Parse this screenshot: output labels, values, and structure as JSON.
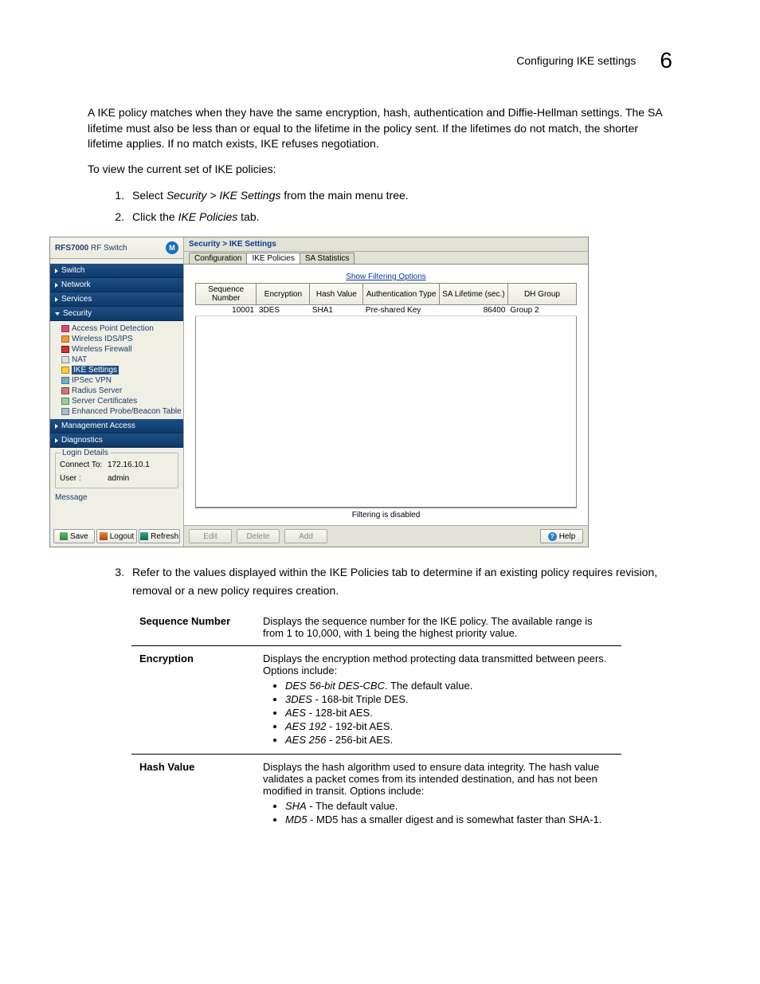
{
  "header": {
    "title": "Configuring IKE settings",
    "page_number": "6"
  },
  "body": {
    "p1": "A IKE policy matches when they have the same encryption, hash, authentication and Diffie-Hellman settings. The SA lifetime must also be less than or equal to the lifetime in the policy sent. If the lifetimes do not match, the shorter lifetime applies. If no match exists, IKE refuses negotiation.",
    "p2": "To view the current set of IKE policies:",
    "step1_prefix": "Select ",
    "step1_em": "Security > IKE Settings",
    "step1_suffix": " from the main menu tree.",
    "step2_prefix": "Click the ",
    "step2_em": "IKE Policies",
    "step2_suffix": " tab.",
    "step3": "Refer to the values displayed within the IKE Policies tab to determine if an existing policy requires revision, removal or a new policy requires creation."
  },
  "shot": {
    "brand_bold": "RFS7000",
    "brand_rest": " RF Switch",
    "logo_text": "M",
    "sections": {
      "switch": "Switch",
      "network": "Network",
      "services": "Services",
      "security": "Security",
      "mgmt": "Management Access",
      "diag": "Diagnostics"
    },
    "tree": {
      "t0": "Access Point Detection",
      "t1": "Wireless IDS/IPS",
      "t2": "Wireless Firewall",
      "t3": "NAT",
      "t4": "IKE Settings",
      "t5": "IPSec VPN",
      "t6": "Radius Server",
      "t7": "Server Certificates",
      "t8": "Enhanced Probe/Beacon Table"
    },
    "login": {
      "title": "Login Details",
      "connect_k": "Connect To:",
      "connect_v": "172.16.10.1",
      "user_k": "User :",
      "user_v": "admin"
    },
    "msg": "Message",
    "footer_btns": {
      "save": "Save",
      "logout": "Logout",
      "refresh": "Refresh"
    },
    "crumb": "Security > IKE Settings",
    "tabs": {
      "t0": "Configuration",
      "t1": "IKE Policies",
      "t2": "SA Statistics"
    },
    "filter_link": "Show Filtering Options",
    "cols": {
      "c0": "Sequence Number",
      "c1": "Encryption",
      "c2": "Hash Value",
      "c3": "Authentication Type",
      "c4": "SA Lifetime (sec.)",
      "c5": "DH Group"
    },
    "row0": {
      "c0": "10001",
      "c1": "3DES",
      "c2": "SHA1",
      "c3": "Pre-shared Key",
      "c4": "86400",
      "c5": "Group 2"
    },
    "filter_msg": "Filtering is disabled",
    "main_btns": {
      "edit": "Edit",
      "delete": "Delete",
      "add": "Add",
      "help": "Help"
    }
  },
  "def": {
    "r0": {
      "term": "Sequence Number",
      "desc": "Displays the sequence number for the IKE policy. The available range is from 1 to 10,000, with 1 being the highest priority value."
    },
    "r1": {
      "term": "Encryption",
      "desc": "Displays the encryption method protecting data transmitted between peers. Options include:",
      "b0_em": "DES 56-bit DES-CBC",
      "b0_txt": ". The default value.",
      "b1_em": "3DES",
      "b1_txt": " - 168-bit Triple DES.",
      "b2_em": "AES",
      "b2_txt": " - 128-bit AES.",
      "b3_em": "AES 192",
      "b3_txt": " - 192-bit AES.",
      "b4_em": "AES 256",
      "b4_txt": " - 256-bit AES."
    },
    "r2": {
      "term": "Hash Value",
      "desc": "Displays the hash algorithm used to ensure data integrity. The hash value validates a packet comes from its intended destination, and has not been modified in transit. Options include:",
      "b0_em": "SHA",
      "b0_txt": " - The default value.",
      "b1_em": "MD5",
      "b1_txt": " - MD5 has a smaller digest and is somewhat faster than SHA-1."
    }
  }
}
